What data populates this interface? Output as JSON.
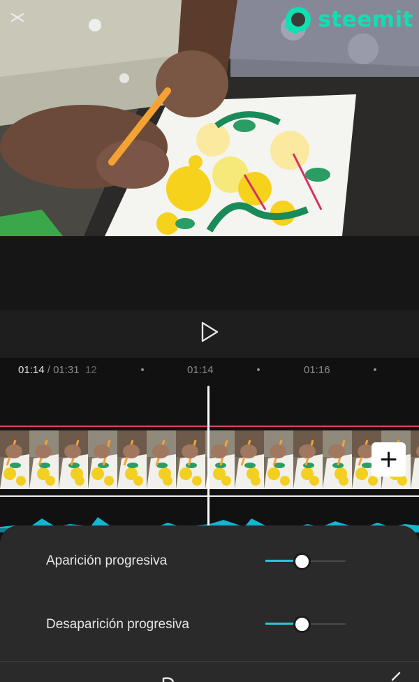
{
  "watermark": {
    "text": "steemit"
  },
  "playback": {
    "current_time": "01:14",
    "separator": " / ",
    "total_time": "01:31"
  },
  "ruler": {
    "labels": [
      "12",
      "01:14",
      "01:16"
    ]
  },
  "fade_settings": {
    "fade_in": {
      "label": "Aparición progresiva",
      "value_fraction": 0.45
    },
    "fade_out": {
      "label": "Desaparición progresiva",
      "value_fraction": 0.45
    }
  },
  "colors": {
    "accent": "#2cc4dc",
    "track_marker": "#e8405f",
    "watermark": "#0ee0b4",
    "audio_wave": "#13b6cf"
  },
  "icons": [
    "capcut-logo-icon",
    "steemit-logo-icon",
    "play-icon",
    "plus-icon",
    "checkmark-icon"
  ]
}
